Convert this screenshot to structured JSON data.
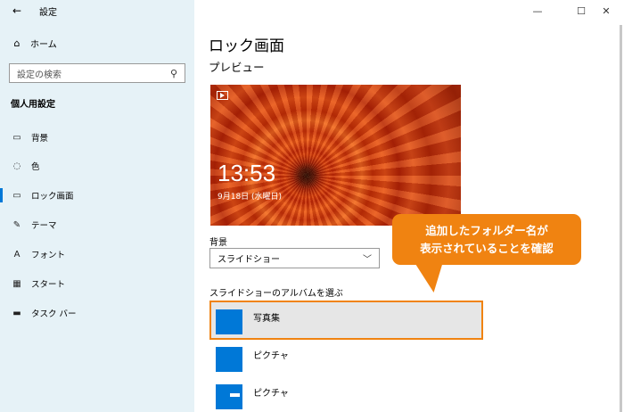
{
  "window": {
    "app_title": "設定",
    "minimize": "—",
    "maximize": "☐",
    "close": "✕"
  },
  "sidebar": {
    "home_label": "ホーム",
    "search_placeholder": "設定の検索",
    "section_title": "個人用設定",
    "items": [
      {
        "label": "背景",
        "icon": "picture-icon"
      },
      {
        "label": "色",
        "icon": "palette-icon"
      },
      {
        "label": "ロック画面",
        "icon": "lock-screen-icon",
        "selected": true
      },
      {
        "label": "テーマ",
        "icon": "theme-icon"
      },
      {
        "label": "フォント",
        "icon": "font-icon"
      },
      {
        "label": "スタート",
        "icon": "start-icon"
      },
      {
        "label": "タスク バー",
        "icon": "taskbar-icon"
      }
    ]
  },
  "main": {
    "page_title": "ロック画面",
    "preview_label": "プレビュー",
    "preview_time": "13:53",
    "preview_date": "9月18日 (水曜日)",
    "background_label": "背景",
    "background_value": "スライドショー",
    "album_label": "スライドショーのアルバムを選ぶ",
    "albums": [
      {
        "name": "写真集"
      },
      {
        "name": "ピクチャ"
      },
      {
        "name": "ピクチャ"
      }
    ]
  },
  "callout": {
    "line1": "追加したフォルダー名が",
    "line2": "表示されていることを確認"
  },
  "colors": {
    "sidebar_bg": "#e6f2f7",
    "accent": "#0078d7",
    "callout": "#f08311"
  }
}
